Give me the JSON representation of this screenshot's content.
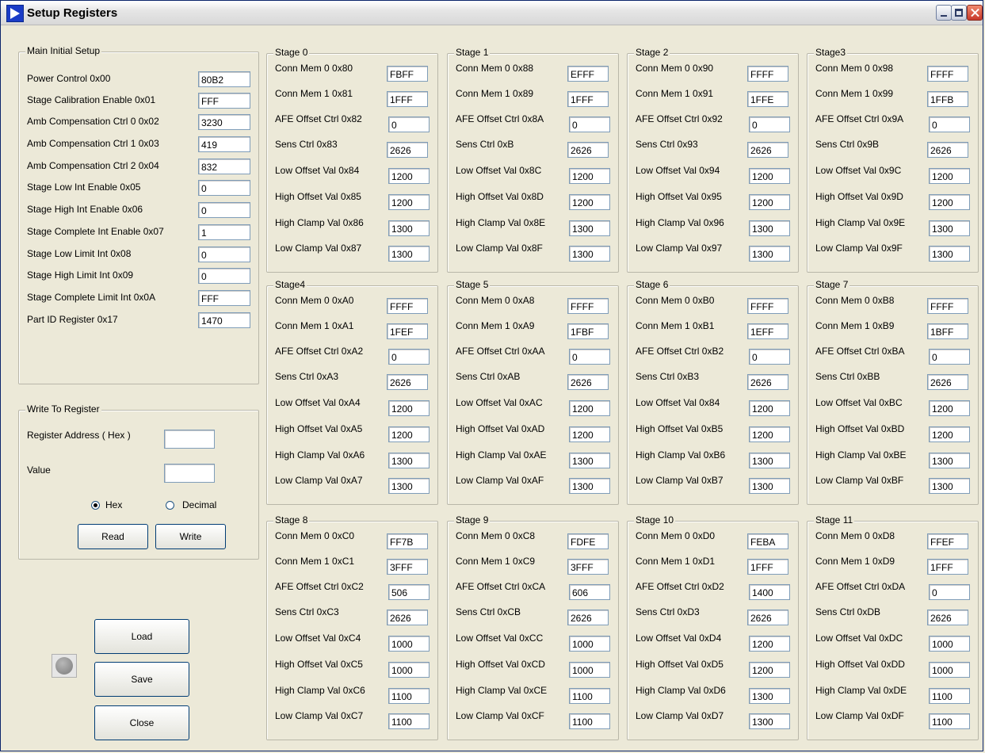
{
  "window": {
    "title": "Setup Registers"
  },
  "main_setup": {
    "legend": "Main Initial Setup",
    "rows": [
      {
        "label": "Power Control  0x00",
        "value": "80B2"
      },
      {
        "label": "Stage Calibration Enable 0x01",
        "value": "FFF"
      },
      {
        "label": "Amb Compensation Ctrl 0 0x02",
        "value": "3230"
      },
      {
        "label": "Amb Compensation Ctrl 1 0x03",
        "value": "419"
      },
      {
        "label": "Amb Compensation Ctrl 2 0x04",
        "value": "832"
      },
      {
        "label": "Stage Low Int Enable 0x05",
        "value": "0"
      },
      {
        "label": "Stage High Int Enable 0x06",
        "value": "0"
      },
      {
        "label": "Stage Complete Int Enable 0x07",
        "value": "1"
      },
      {
        "label": "Stage Low Limit Int 0x08",
        "value": "0"
      },
      {
        "label": "Stage High Limit Int 0x09",
        "value": "0"
      },
      {
        "label": "Stage Complete Limit Int 0x0A",
        "value": "FFF"
      },
      {
        "label": "Part ID Register 0x17",
        "value": "1470"
      }
    ]
  },
  "write_register": {
    "legend": "Write To Register",
    "address_label": "Register Address ( Hex )",
    "address_value": "",
    "value_label": "Value",
    "value_value": "",
    "hex_label": "Hex",
    "decimal_label": "Decimal",
    "read_button": "Read",
    "write_button": "Write"
  },
  "buttons": {
    "load": "Load",
    "save": "Save",
    "close": "Close"
  },
  "stages": [
    {
      "legend": "Stage 0",
      "rows": [
        {
          "label": "Conn Mem 0 0x80",
          "value": "FBFF"
        },
        {
          "label": "Conn Mem 1 0x81",
          "value": "1FFF"
        },
        {
          "label": "AFE Offset Ctrl 0x82",
          "value": "0"
        },
        {
          "label": "Sens Ctrl 0x83",
          "value": "2626"
        },
        {
          "label": "Low Offset Val 0x84",
          "value": "1200"
        },
        {
          "label": "High Offset Val 0x85",
          "value": "1200"
        },
        {
          "label": "High Clamp Val 0x86",
          "value": "1300"
        },
        {
          "label": "Low Clamp Val 0x87",
          "value": "1300"
        }
      ]
    },
    {
      "legend": "Stage 1",
      "rows": [
        {
          "label": "Conn Mem 0 0x88",
          "value": "EFFF"
        },
        {
          "label": "Conn Mem 1 0x89",
          "value": "1FFF"
        },
        {
          "label": "AFE Offset Ctrl 0x8A",
          "value": "0"
        },
        {
          "label": "Sens Ctrl 0xB",
          "value": "2626"
        },
        {
          "label": "Low Offset Val 0x8C",
          "value": "1200"
        },
        {
          "label": "High Offset Val 0x8D",
          "value": "1200"
        },
        {
          "label": "High Clamp Val 0x8E",
          "value": "1300"
        },
        {
          "label": "Low Clamp Val 0x8F",
          "value": "1300"
        }
      ]
    },
    {
      "legend": "Stage 2",
      "rows": [
        {
          "label": "Conn Mem 0 0x90",
          "value": "FFFF"
        },
        {
          "label": "Conn Mem 1 0x91",
          "value": "1FFE"
        },
        {
          "label": "AFE Offset Ctrl 0x92",
          "value": "0"
        },
        {
          "label": "Sens Ctrl 0x93",
          "value": "2626"
        },
        {
          "label": "Low Offset Val 0x94",
          "value": "1200"
        },
        {
          "label": "High Offset Val 0x95",
          "value": "1200"
        },
        {
          "label": "High Clamp Val 0x96",
          "value": "1300"
        },
        {
          "label": "Low Clamp Val 0x97",
          "value": "1300"
        }
      ]
    },
    {
      "legend": "Stage3",
      "rows": [
        {
          "label": "Conn Mem 0 0x98",
          "value": "FFFF"
        },
        {
          "label": "Conn Mem 1 0x99",
          "value": "1FFB"
        },
        {
          "label": "AFE Offset Ctrl  0x9A",
          "value": "0"
        },
        {
          "label": "Sens Ctrl 0x9B",
          "value": "2626"
        },
        {
          "label": "Low Offset Val 0x9C",
          "value": "1200"
        },
        {
          "label": "High Offset Val 0x9D",
          "value": "1200"
        },
        {
          "label": "High Clamp Val 0x9E",
          "value": "1300"
        },
        {
          "label": "Low Clamp Val 0x9F",
          "value": "1300"
        }
      ]
    },
    {
      "legend": "Stage4",
      "rows": [
        {
          "label": "Conn Mem 0 0xA0",
          "value": "FFFF"
        },
        {
          "label": "Conn Mem 1 0xA1",
          "value": "1FEF"
        },
        {
          "label": "AFE Offset Ctrl 0xA2",
          "value": "0"
        },
        {
          "label": "Sens Ctrl 0xA3",
          "value": "2626"
        },
        {
          "label": "Low Offset Val 0xA4",
          "value": "1200"
        },
        {
          "label": "High Offset Val 0xA5",
          "value": "1200"
        },
        {
          "label": "High Clamp Val 0xA6",
          "value": "1300"
        },
        {
          "label": "Low Clamp Val 0xA7",
          "value": "1300"
        }
      ]
    },
    {
      "legend": "Stage 5",
      "rows": [
        {
          "label": "Conn Mem 0 0xA8",
          "value": "FFFF"
        },
        {
          "label": "Conn Mem 1 0xA9",
          "value": "1FBF"
        },
        {
          "label": "AFE Offset Ctrl 0xAA",
          "value": "0"
        },
        {
          "label": "Sens Ctrl 0xAB",
          "value": "2626"
        },
        {
          "label": "Low Offset Val 0xAC",
          "value": "1200"
        },
        {
          "label": "High Offset Val 0xAD",
          "value": "1200"
        },
        {
          "label": "High Clamp Val 0xAE",
          "value": "1300"
        },
        {
          "label": "Low Clamp Val 0xAF",
          "value": "1300"
        }
      ]
    },
    {
      "legend": "Stage 6",
      "rows": [
        {
          "label": "Conn Mem 0 0xB0",
          "value": "FFFF"
        },
        {
          "label": "Conn Mem 1 0xB1",
          "value": "1EFF"
        },
        {
          "label": "AFE Offset Ctrl 0xB2",
          "value": "0"
        },
        {
          "label": "Sens Ctrl 0xB3",
          "value": "2626"
        },
        {
          "label": "Low Offset Val 0x84",
          "value": "1200"
        },
        {
          "label": "High Offset Val 0xB5",
          "value": "1200"
        },
        {
          "label": "High Clamp Val 0xB6",
          "value": "1300"
        },
        {
          "label": "Low Clamp Val 0xB7",
          "value": "1300"
        }
      ]
    },
    {
      "legend": "Stage 7",
      "rows": [
        {
          "label": "Conn Mem 0 0xB8",
          "value": "FFFF"
        },
        {
          "label": "Conn Mem 1 0xB9",
          "value": "1BFF"
        },
        {
          "label": "AFE Offset Ctrl 0xBA",
          "value": "0"
        },
        {
          "label": "Sens Ctrl 0xBB",
          "value": "2626"
        },
        {
          "label": "Low Offset Val 0xBC",
          "value": "1200"
        },
        {
          "label": "High Offset Val 0xBD",
          "value": "1200"
        },
        {
          "label": "High Clamp Val 0xBE",
          "value": "1300"
        },
        {
          "label": "Low Clamp Val 0xBF",
          "value": "1300"
        }
      ]
    },
    {
      "legend": "Stage 8",
      "rows": [
        {
          "label": "Conn Mem 0 0xC0",
          "value": "FF7B"
        },
        {
          "label": "Conn Mem 1 0xC1",
          "value": "3FFF"
        },
        {
          "label": "AFE Offset Ctrl 0xC2",
          "value": "506"
        },
        {
          "label": "Sens Ctrl 0xC3",
          "value": "2626"
        },
        {
          "label": "Low Offset Val 0xC4",
          "value": "1000"
        },
        {
          "label": "High Offset Val 0xC5",
          "value": "1000"
        },
        {
          "label": "High Clamp Val 0xC6",
          "value": "1100"
        },
        {
          "label": "Low Clamp Val 0xC7",
          "value": "1100"
        }
      ]
    },
    {
      "legend": "Stage 9",
      "rows": [
        {
          "label": "Conn Mem 0 0xC8",
          "value": "FDFE"
        },
        {
          "label": "Conn Mem 1 0xC9",
          "value": "3FFF"
        },
        {
          "label": "AFE Offset Ctrl 0xCA",
          "value": "606"
        },
        {
          "label": "Sens Ctrl 0xCB",
          "value": "2626"
        },
        {
          "label": "Low Offset Val 0xCC",
          "value": "1000"
        },
        {
          "label": "High Offset Val 0xCD",
          "value": "1000"
        },
        {
          "label": "High Clamp Val 0xCE",
          "value": "1100"
        },
        {
          "label": "Low Clamp Val 0xCF",
          "value": "1100"
        }
      ]
    },
    {
      "legend": "Stage 10",
      "rows": [
        {
          "label": "Conn Mem 0 0xD0",
          "value": "FEBA"
        },
        {
          "label": "Conn Mem 1 0xD1",
          "value": "1FFF"
        },
        {
          "label": "AFE Offset Ctrl 0xD2",
          "value": "1400"
        },
        {
          "label": "Sens Ctrl 0xD3",
          "value": "2626"
        },
        {
          "label": "Low Offset Val 0xD4",
          "value": "1200"
        },
        {
          "label": "High Offset Val 0xD5",
          "value": "1200"
        },
        {
          "label": "High Clamp Val 0xD6",
          "value": "1300"
        },
        {
          "label": "Low Clamp Val 0xD7",
          "value": "1300"
        }
      ]
    },
    {
      "legend": "Stage 11",
      "rows": [
        {
          "label": "Conn Mem 0 0xD8",
          "value": "FFEF"
        },
        {
          "label": "Conn Mem 1 0xD9",
          "value": "1FFF"
        },
        {
          "label": "AFE Offset Ctrl 0xDA",
          "value": "0"
        },
        {
          "label": "Sens Ctrl 0xDB",
          "value": "2626"
        },
        {
          "label": "Low Offset Val 0xDC",
          "value": "1000"
        },
        {
          "label": "High Offset Val 0xDD",
          "value": "1000"
        },
        {
          "label": "High Clamp Val 0xDE",
          "value": "1100"
        },
        {
          "label": "Low Clamp Val 0xDF",
          "value": "1100"
        }
      ]
    }
  ]
}
